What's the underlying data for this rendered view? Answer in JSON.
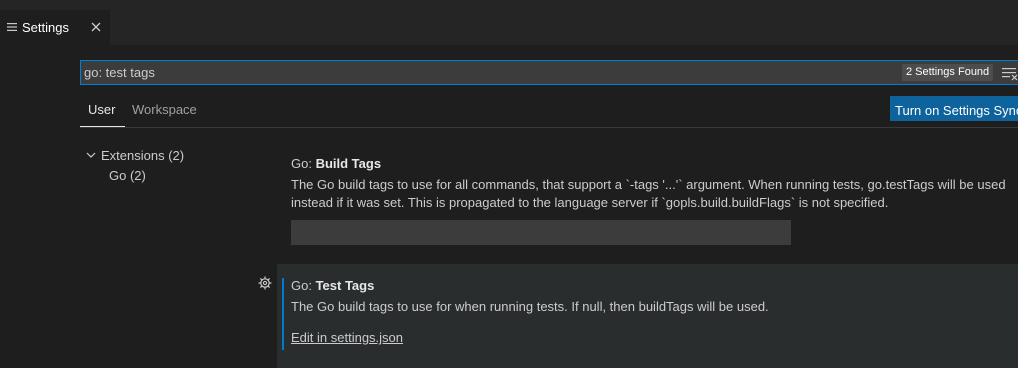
{
  "tab": {
    "label": "Settings",
    "icon": "settings-list-icon",
    "close_icon": "close-icon"
  },
  "search": {
    "value": "go: test tags",
    "count_badge": "2 Settings Found",
    "clear_icon": "clear-filter-icon"
  },
  "scopes": {
    "user": "User",
    "workspace": "Workspace",
    "sync_button": "Turn on Settings Sync"
  },
  "toc": {
    "group_label": "Extensions (2)",
    "child_label": "Go (2)",
    "chevron_icon": "chevron-down-icon"
  },
  "settings": [
    {
      "category": "Go: ",
      "name": "Build Tags",
      "description": "The Go build tags to use for all commands, that support a `-tags '...'` argument. When running tests, go.testTags will be used instead if it was set. This is propagated to the language server if `gopls.build.buildFlags` is not specified.",
      "value": ""
    },
    {
      "category": "Go: ",
      "name": "Test Tags",
      "description": "The Go build tags to use for when running tests. If null, then buildTags will be used.",
      "link": "Edit in settings.json",
      "gear_icon": "gear-icon"
    }
  ],
  "colors": {
    "accent": "#007fd4",
    "button": "#0e639c",
    "focus_bar": "#007acc",
    "background": "#1e1e1e"
  }
}
